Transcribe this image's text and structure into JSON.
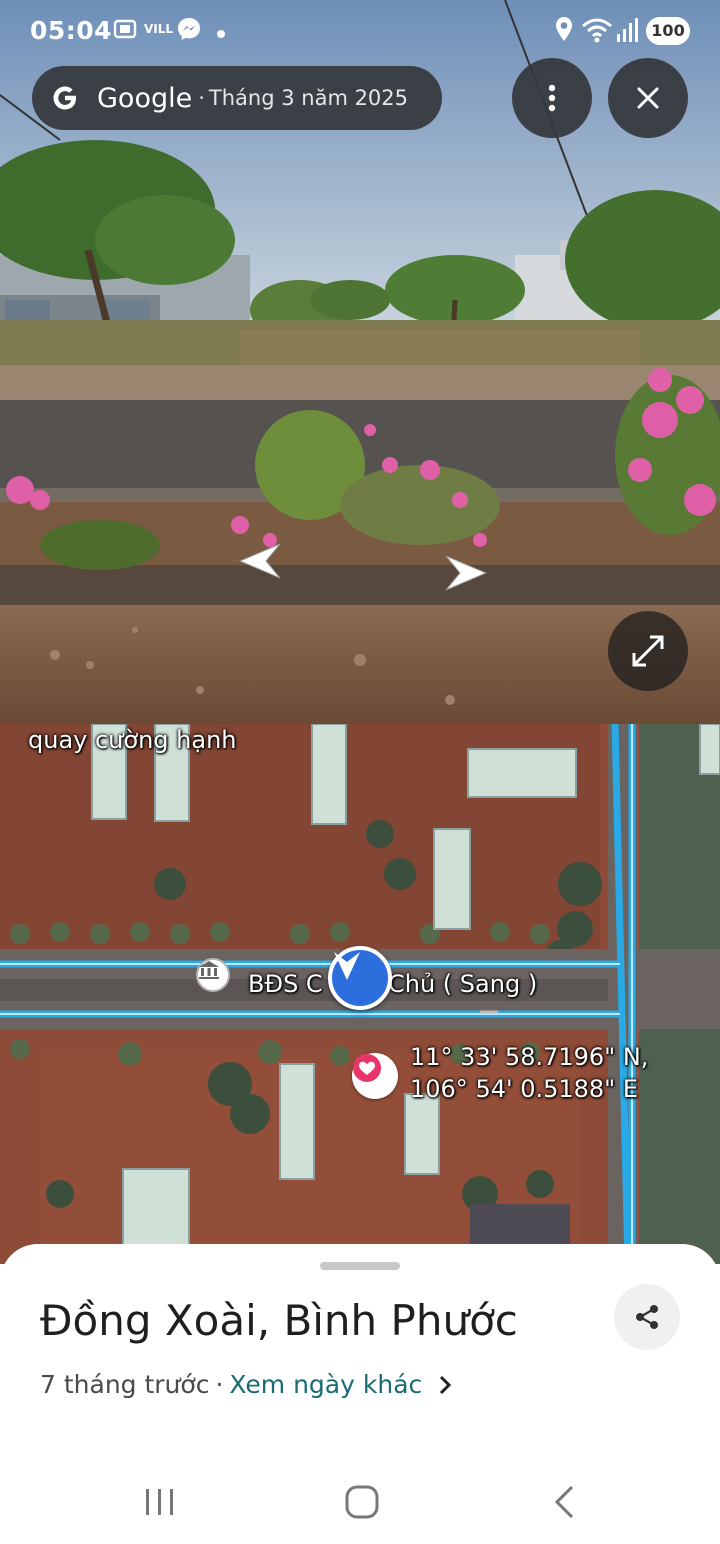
{
  "status_bar": {
    "time": "05:04",
    "network_label": "VILL",
    "battery": "100"
  },
  "street_view": {
    "provider": "Google",
    "separator": "·",
    "capture_date": "Tháng 3 năm 2025",
    "icons": [
      "google-g-icon",
      "more-vert-icon",
      "close-icon",
      "arrow-left-icon",
      "arrow-right-icon",
      "expand-icon"
    ]
  },
  "map": {
    "top_label": "quay cường hạnh",
    "poi_label": "BĐS C",
    "poi_label_tail": "Chủ ( Sang )",
    "coordinates": {
      "lat": "11° 33' 58.7196\" N,",
      "lon": "106° 54' 0.5188\" E"
    },
    "colors": {
      "road_highlight": "#29a9e6",
      "pegman": "#2c6fdc",
      "pin": "#e8356b"
    }
  },
  "sheet": {
    "title": "Đồng Xoài, Bình Phước",
    "ago": "7 tháng trước",
    "dot": "·",
    "link": "Xem ngày khác"
  },
  "nav_bar": {
    "icons": [
      "recents-icon",
      "home-icon",
      "back-icon"
    ]
  }
}
